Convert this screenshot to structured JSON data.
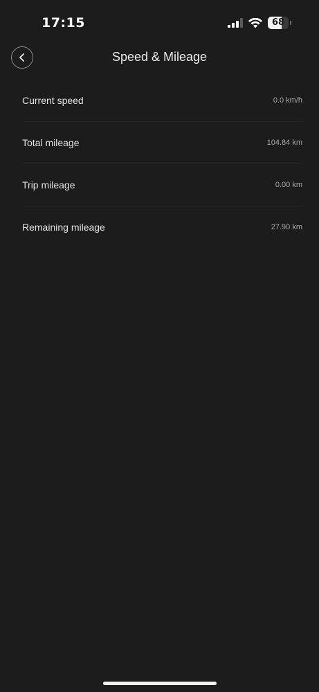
{
  "status_bar": {
    "time": "17:15",
    "battery_level": "68",
    "battery_fraction": 0.68,
    "icons": [
      "cellular-signal-icon",
      "wifi-icon",
      "battery-icon"
    ]
  },
  "header": {
    "title": "Speed & Mileage",
    "back_icon": "chevron-left-icon"
  },
  "rows": [
    {
      "label": "Current speed",
      "value": "0.0 km/h"
    },
    {
      "label": "Total mileage",
      "value": "104.84 km"
    },
    {
      "label": "Trip mileage",
      "value": "0.00 km"
    },
    {
      "label": "Remaining mileage",
      "value": "27.90 km"
    }
  ],
  "colors": {
    "background": "#1c1c1c",
    "text_primary": "#e2e2e2",
    "text_secondary": "#a9a9a9"
  }
}
